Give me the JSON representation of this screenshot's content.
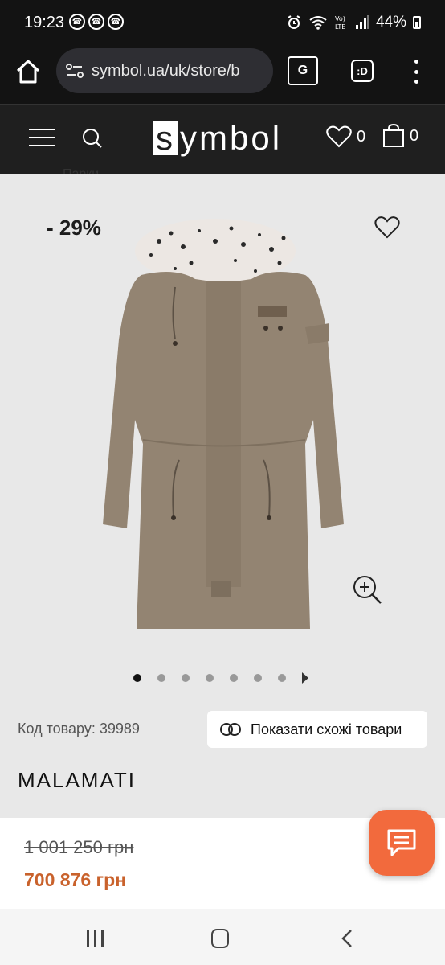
{
  "status_bar": {
    "time": "19:23",
    "battery": "44%"
  },
  "browser": {
    "url": "symbol.ua/uk/store/b"
  },
  "site_header": {
    "logo_initial": "s",
    "logo_rest": "ymbol",
    "wishlist_count": "0",
    "cart_count": "0"
  },
  "breadcrumb": {
    "label": "Парки"
  },
  "product": {
    "discount": "- 29%",
    "sku": "Код товару: 39989",
    "similar_button": "Показати схожі товари",
    "brand": "MALAMATI",
    "old_price": "1 001 250 грн",
    "new_price": "700 876 грн"
  },
  "gallery": {
    "total_dots": 7,
    "active_index": 0
  },
  "colors": {
    "accent": "#c9622c",
    "chat_button": "#f26a3d",
    "header_bg": "#1f1f1f"
  },
  "icons": [
    "home-icon",
    "settings-icon",
    "translate-icon",
    "dex-icon",
    "menu-dots-icon",
    "hamburger-icon",
    "search-icon",
    "heart-icon",
    "bag-icon",
    "zoom-icon",
    "chat-icon"
  ]
}
